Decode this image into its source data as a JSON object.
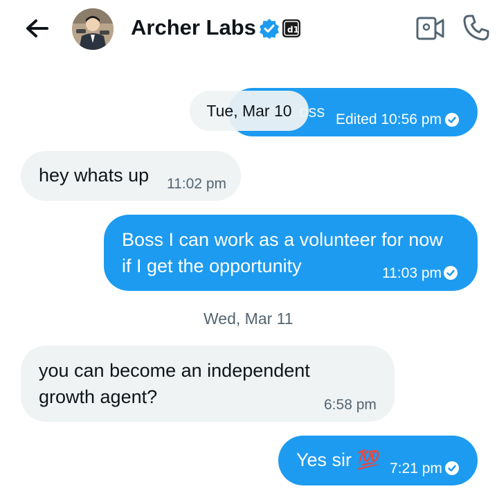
{
  "header": {
    "title": "Archer Labs",
    "icons": {
      "back": "back-arrow-icon",
      "verified": "verified-badge-icon",
      "affiliate": "affiliate-badge-icon",
      "video": "video-call-icon",
      "call": "phone-icon"
    }
  },
  "conversation": {
    "pinned_date": "Tue, Mar 10",
    "messages": [
      {
        "side": "sent",
        "text": "…oss",
        "time": "Edited 10:56 pm",
        "status": "read"
      },
      {
        "side": "received",
        "text": "hey whats up",
        "time": "11:02 pm"
      },
      {
        "side": "sent",
        "lines": [
          "Boss I can work as a volunteer for now",
          "if I get the opportunity"
        ],
        "time": "11:03 pm",
        "status": "read"
      },
      {
        "side": "received",
        "lines": [
          "you can become an independent",
          "growth agent?"
        ],
        "time": "6:58 pm"
      },
      {
        "side": "sent",
        "text": "Yes sir 💯",
        "time": "7:21 pm",
        "status": "read"
      }
    ],
    "date_separator": "Wed, Mar 11"
  },
  "colors": {
    "sent_bubble": "#1d9bf0",
    "received_bubble": "#eff3f4",
    "secondary_text": "#536471",
    "primary_text": "#0f1419"
  }
}
